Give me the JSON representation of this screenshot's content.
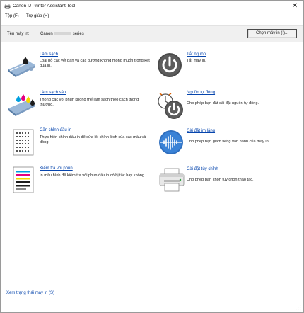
{
  "window": {
    "title": "Canon IJ Printer Assistant Tool"
  },
  "menu": {
    "file": "Tệp (F)",
    "help": "Trợ giúp (H)"
  },
  "printer": {
    "label": "Tên máy in:",
    "name_prefix": "Canon",
    "name_suffix": "series",
    "select_button": "Chọn máy in (I)..."
  },
  "left_items": [
    {
      "link": "Làm sạch",
      "desc": "Loại bỏ các vết bẩn và các đường không mong muốn trong kết quả in.",
      "icon": "cleaning-icon"
    },
    {
      "link": "Làm sạch sâu",
      "desc": "Thông các vòi phun không thể làm sạch theo cách thông thường.",
      "icon": "deep-cleaning-icon"
    },
    {
      "link": "Căn chỉnh đầu in",
      "desc": "Thực hiện chỉnh đầu in để sửa lỗi chỉnh lệch của các màu và dòng.",
      "icon": "print-head-alignment-icon"
    },
    {
      "link": "Kiểm tra vòi phun",
      "desc": "In mẫu hình để kiểm tra vòi phun đầu in có bị tắc hay không.",
      "icon": "nozzle-check-icon"
    }
  ],
  "right_items": [
    {
      "link": "Tắt nguồn",
      "desc": "Tắt máy in.",
      "icon": "power-off-icon"
    },
    {
      "link": "Nguồn tự động",
      "desc": "Cho phép bạn đặt cài đặt nguồn tự động.",
      "icon": "auto-power-icon"
    },
    {
      "link": "Cài đặt im lặng",
      "desc": "Cho phép bạn giảm tiếng vận hành của máy in.",
      "icon": "quiet-settings-icon"
    },
    {
      "link": "Cài đặt tùy chỉnh",
      "desc": "Cho phép bạn chọn tùy chọn thao tác.",
      "icon": "custom-settings-icon"
    }
  ],
  "footer": {
    "status_link": "Xem trạng thái máy in (S)"
  }
}
